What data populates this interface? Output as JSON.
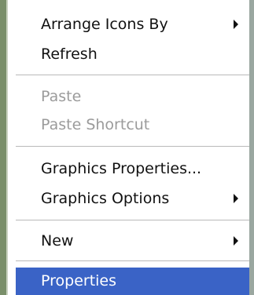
{
  "context_menu": {
    "items": [
      {
        "label": "Arrange Icons By",
        "enabled": true,
        "submenu": true
      },
      {
        "label": "Refresh",
        "enabled": true,
        "submenu": false
      },
      {
        "label": "Paste",
        "enabled": false,
        "submenu": false
      },
      {
        "label": "Paste Shortcut",
        "enabled": false,
        "submenu": false
      },
      {
        "label": "Graphics Properties...",
        "enabled": true,
        "submenu": false
      },
      {
        "label": "Graphics Options",
        "enabled": true,
        "submenu": true
      },
      {
        "label": "New",
        "enabled": true,
        "submenu": true
      },
      {
        "label": "Properties",
        "enabled": true,
        "submenu": false,
        "highlighted": true
      }
    ],
    "colors": {
      "highlight": "#3a63c6",
      "disabled_text": "#9b9b9b",
      "text": "#111111"
    }
  }
}
